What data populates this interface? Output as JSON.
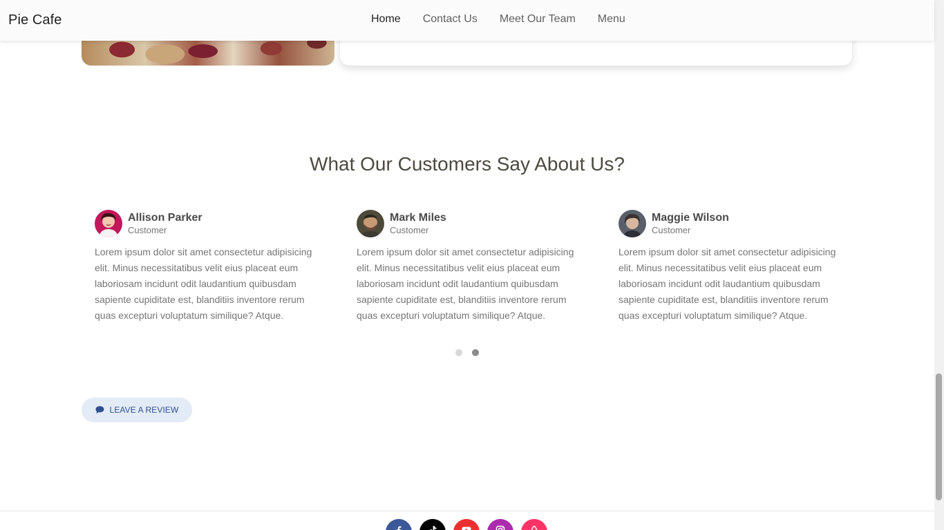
{
  "navbar": {
    "brand": "Pie Cafe",
    "links": [
      {
        "label": "Home",
        "active": true
      },
      {
        "label": "Contact Us",
        "active": false
      },
      {
        "label": "Meet Our Team",
        "active": false
      },
      {
        "label": "Menu",
        "active": false
      }
    ]
  },
  "testimonials_section": {
    "title": "What Our Customers Say About Us?",
    "items": [
      {
        "name": "Allison Parker",
        "role": "Customer",
        "text": "Lorem ipsum dolor sit amet consectetur adipisicing elit. Minus necessitatibus velit eius placeat eum laboriosam incidunt odit laudantium quibusdam sapiente cupiditate est, blanditiis inventore rerum quas excepturi voluptatum similique? Atque."
      },
      {
        "name": "Mark Miles",
        "role": "Customer",
        "text": "Lorem ipsum dolor sit amet consectetur adipisicing elit. Minus necessitatibus velit eius placeat eum laboriosam incidunt odit laudantium quibusdam sapiente cupiditate est, blanditiis inventore rerum quas excepturi voluptatum similique? Atque."
      },
      {
        "name": "Maggie Wilson",
        "role": "Customer",
        "text": "Lorem ipsum dolor sit amet consectetur adipisicing elit. Minus necessitatibus velit eius placeat eum laboriosam incidunt odit laudantium quibusdam sapiente cupiditate est, blanditiis inventore rerum quas excepturi voluptatum similique? Atque."
      }
    ],
    "carousel": {
      "pages": 2,
      "active_page": 2
    }
  },
  "review_button": {
    "label": "LEAVE A REVIEW",
    "icon": "comment-icon"
  },
  "footer": {
    "social": [
      {
        "name": "facebook-icon",
        "color": "#3b5998"
      },
      {
        "name": "tiktok-icon",
        "color": "#000000"
      },
      {
        "name": "youtube-icon",
        "color": "#ed302f"
      },
      {
        "name": "instagram-icon",
        "color": "#ac2bac"
      },
      {
        "name": "airbnb-icon",
        "color": "#ff3366"
      }
    ]
  },
  "colors": {
    "accent_text": "#2f4f8f",
    "review_button_bg": "#e3ebf7",
    "heading": "#4a4a40"
  }
}
